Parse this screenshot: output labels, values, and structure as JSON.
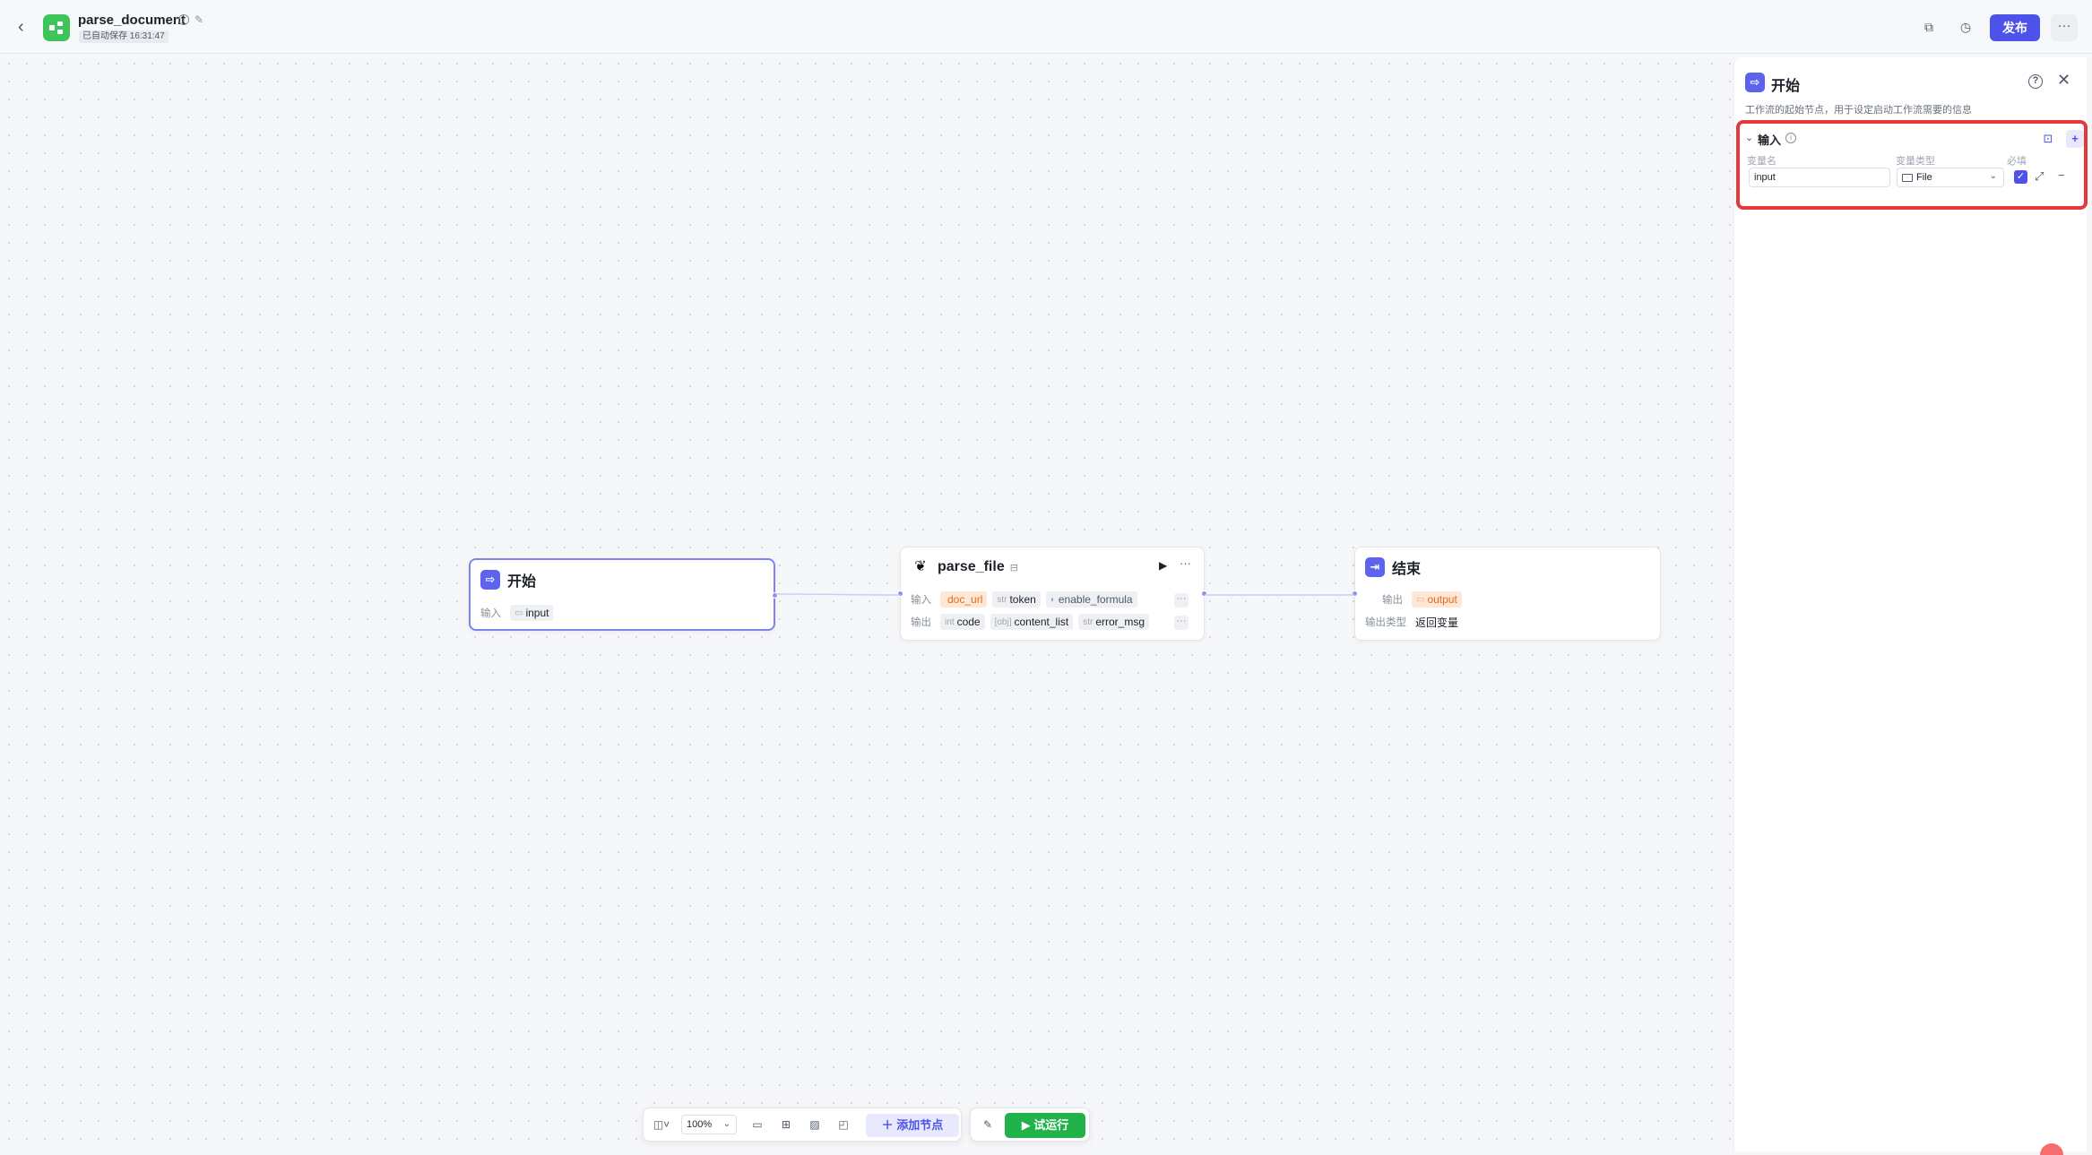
{
  "header": {
    "app_title": "parse_document",
    "saved_text": "已自动保存 16:31:47",
    "publish_label": "发布",
    "more_label": "···"
  },
  "colors": {
    "accent": "#4d53e8",
    "app_icon": "#3ec55a",
    "run": "#22b24c",
    "highlight": "#e5383b"
  },
  "nodes": {
    "start": {
      "title": "开始",
      "input_label": "输入",
      "input_var": "input"
    },
    "parse": {
      "title": "parse_file",
      "input_label": "输入",
      "output_label": "输出",
      "inputs": [
        {
          "type": "",
          "name": "doc_url"
        },
        {
          "type": "str",
          "name": "token"
        },
        {
          "type": "",
          "name": "enable_formula"
        }
      ],
      "outputs": [
        {
          "type": "int",
          "name": "code"
        },
        {
          "type": "[obj]",
          "name": "content_list"
        },
        {
          "type": "str",
          "name": "error_msg"
        }
      ]
    },
    "end": {
      "title": "结束",
      "output_label": "输出",
      "output_var": "output",
      "output_type_label": "输出类型",
      "output_type_value": "返回变量"
    }
  },
  "panel": {
    "title": "开始",
    "description": "工作流的起始节点，用于设定启动工作流需要的信息",
    "section_title": "输入",
    "col_var_name": "变量名",
    "col_var_type": "变量类型",
    "col_required": "必填",
    "var_name_value": "input",
    "var_type_value": "File"
  },
  "toolbar": {
    "zoom": "100%",
    "add_node": "添加节点",
    "run": "试运行"
  }
}
